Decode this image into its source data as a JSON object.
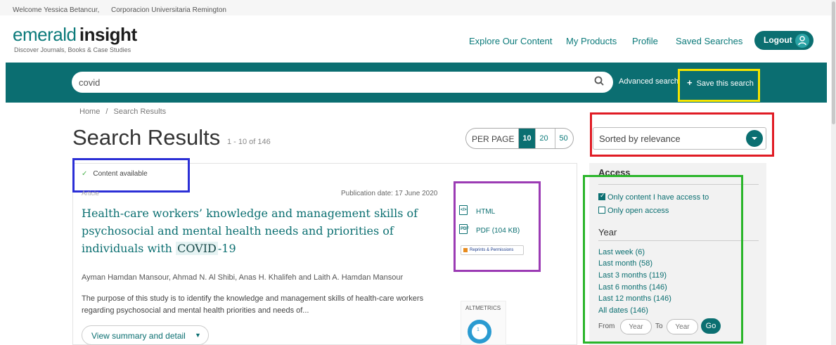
{
  "topbar": {
    "welcome": "Welcome Yessica Betancur,",
    "institution": "Corporacion Universitaria Remington"
  },
  "logo": {
    "part1": "emerald",
    "part2": "insight",
    "tagline": "Discover Journals, Books & Case Studies"
  },
  "nav": {
    "explore": "Explore Our Content",
    "products": "My Products",
    "profile": "Profile",
    "saved": "Saved Searches",
    "logout": "Logout"
  },
  "search": {
    "value": "covid",
    "advanced": "Advanced search",
    "save": "Save this search"
  },
  "breadcrumb": {
    "home": "Home",
    "sep": "/",
    "current": "Search Results"
  },
  "results": {
    "title": "Search Results",
    "count": "1 - 10 of 146"
  },
  "perpage": {
    "label": "PER PAGE",
    "options": [
      "10",
      "20",
      "50"
    ],
    "selected": "10"
  },
  "sort": {
    "value": "Sorted by relevance"
  },
  "article": {
    "content_available": "Content available",
    "type": "Article",
    "pubdate": "Publication date: 17 June 2020",
    "title_part1": "Health-care workers’ knowledge and management skills of psychosocial and mental health needs and priorities of individuals with",
    "title_highlight": "COVID",
    "title_part2": "-19",
    "authors": "Ayman Hamdan Mansour, Ahmad N. Al Shibi, Anas H. Khalifeh and Laith A. Hamdan Mansour",
    "abstract": "The purpose of this study is to identify the knowledge and management skills of health-care workers regarding psychosocial and mental health priorities and needs of...",
    "view_button": "View summary and detail",
    "html_link": "HTML",
    "pdf_link": "PDF (104 KB)",
    "reprints": "Reprints & Permissions",
    "altmetrics": "ALTMETRICS",
    "altmetric_score": "1"
  },
  "sidebar": {
    "access_heading": "Access",
    "only_access": "Only content I have access to",
    "only_open": "Only open access",
    "year_heading": "Year",
    "years": [
      "Last week (6)",
      "Last month (58)",
      "Last 3 months (119)",
      "Last 6 months (146)",
      "Last 12 months (146)",
      "All dates (146)"
    ],
    "from_label": "From",
    "to_label": "To",
    "year_placeholder": "Year",
    "go": "Go"
  },
  "colors": {
    "brand": "#0b6f71",
    "annotation_yellow": "#f5e400",
    "annotation_red": "#e01b24",
    "annotation_blue": "#2b2fd6",
    "annotation_purple": "#9b3bb4",
    "annotation_green": "#2ab52a"
  }
}
